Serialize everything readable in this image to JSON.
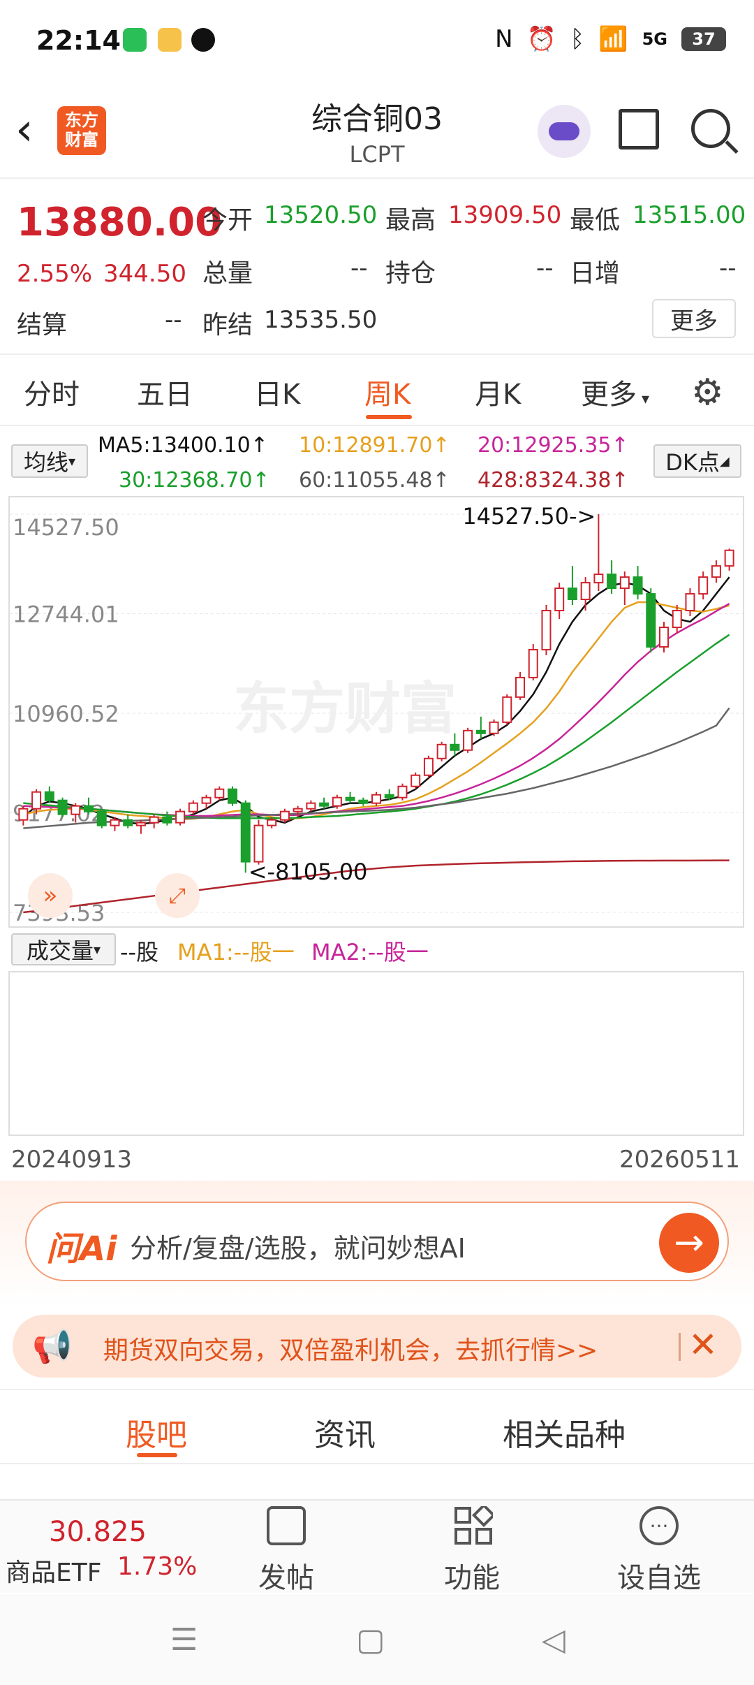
{
  "status_bar": {
    "time": "22:14",
    "battery": "37",
    "network": "5G"
  },
  "header": {
    "logo_line1": "东方",
    "logo_line2": "财富",
    "title": "综合铜03",
    "subtitle": "LCPT"
  },
  "quote": {
    "price": "13880.00",
    "pct": "2.55%",
    "change": "344.50",
    "open_label": "今开",
    "open": "13520.50",
    "high_label": "最高",
    "high": "13909.50",
    "low_label": "最低",
    "low": "13515.00",
    "volume_label": "总量",
    "volume": "--",
    "oi_label": "持仓",
    "oi": "--",
    "daily_inc_label": "日增",
    "daily_inc": "--",
    "settle_label": "结算",
    "settle": "--",
    "prev_settle_label": "昨结",
    "prev_settle": "13535.50",
    "more": "更多"
  },
  "period_tabs": [
    "分时",
    "五日",
    "日K",
    "周K",
    "月K",
    "更多"
  ],
  "ma": {
    "selector": "均线",
    "ma5": "MA5:13400.10↑",
    "ma10": "10:12891.70↑",
    "ma20": "20:12925.35↑",
    "ma30": "30:12368.70↑",
    "ma60": "60:11055.48↑",
    "ma428": "428:8324.38↑",
    "dk": "DK点"
  },
  "colors": {
    "ma5": "#111111",
    "ma10": "#e6a01e",
    "ma20": "#c8259a",
    "ma30": "#1a9f2c",
    "ma60": "#666666",
    "ma428": "#b0242c",
    "up": "#d0232d",
    "down": "#1a9f2c",
    "accent": "#f05a22"
  },
  "chart_data": {
    "type": "candlestick",
    "y_ticks": [
      "14527.50",
      "12744.01",
      "10960.52",
      "9177.02",
      "7393.53"
    ],
    "ylim": [
      7393.53,
      14527.5
    ],
    "max_label": "14527.50->",
    "min_label": "<-8105.00",
    "x_start": "20240913",
    "x_end": "20260511",
    "watermark": "东方财富",
    "candles_ohlc": [
      [
        9050,
        9300,
        8950,
        9250
      ],
      [
        9250,
        9600,
        9150,
        9550
      ],
      [
        9550,
        9650,
        9350,
        9400
      ],
      [
        9400,
        9450,
        9100,
        9150
      ],
      [
        9150,
        9350,
        9000,
        9300
      ],
      [
        9300,
        9450,
        9150,
        9200
      ],
      [
        9200,
        9250,
        8900,
        8950
      ],
      [
        8950,
        9100,
        8850,
        9050
      ],
      [
        9050,
        9150,
        8900,
        8950
      ],
      [
        8950,
        9050,
        8800,
        9000
      ],
      [
        9000,
        9150,
        8900,
        9100
      ],
      [
        9100,
        9200,
        8950,
        9000
      ],
      [
        9000,
        9250,
        8950,
        9200
      ],
      [
        9200,
        9400,
        9150,
        9350
      ],
      [
        9350,
        9500,
        9250,
        9450
      ],
      [
        9450,
        9650,
        9400,
        9600
      ],
      [
        9600,
        9650,
        9300,
        9350
      ],
      [
        9350,
        9400,
        8105,
        8300
      ],
      [
        8300,
        9050,
        8250,
        8950
      ],
      [
        8950,
        9100,
        8900,
        9050
      ],
      [
        9050,
        9250,
        9000,
        9200
      ],
      [
        9200,
        9300,
        9100,
        9250
      ],
      [
        9250,
        9400,
        9200,
        9350
      ],
      [
        9350,
        9450,
        9250,
        9300
      ],
      [
        9300,
        9500,
        9250,
        9450
      ],
      [
        9450,
        9550,
        9350,
        9400
      ],
      [
        9400,
        9450,
        9300,
        9350
      ],
      [
        9350,
        9550,
        9300,
        9500
      ],
      [
        9500,
        9600,
        9400,
        9450
      ],
      [
        9450,
        9700,
        9400,
        9650
      ],
      [
        9650,
        9900,
        9600,
        9850
      ],
      [
        9850,
        10200,
        9800,
        10150
      ],
      [
        10150,
        10450,
        10100,
        10400
      ],
      [
        10400,
        10600,
        10200,
        10300
      ],
      [
        10300,
        10700,
        10250,
        10650
      ],
      [
        10650,
        10900,
        10500,
        10600
      ],
      [
        10600,
        10850,
        10550,
        10800
      ],
      [
        10800,
        11300,
        10750,
        11250
      ],
      [
        11250,
        11700,
        11200,
        11600
      ],
      [
        11600,
        12200,
        11550,
        12100
      ],
      [
        12100,
        12900,
        12000,
        12800
      ],
      [
        12800,
        13300,
        12650,
        13200
      ],
      [
        13200,
        13600,
        12900,
        13000
      ],
      [
        13000,
        13400,
        12800,
        13300
      ],
      [
        13300,
        14527.5,
        13150,
        13450
      ],
      [
        13450,
        13700,
        13100,
        13200
      ],
      [
        13200,
        13500,
        12900,
        13400
      ],
      [
        13400,
        13600,
        13000,
        13100
      ],
      [
        13100,
        13200,
        12050,
        12150
      ],
      [
        12150,
        12600,
        12050,
        12500
      ],
      [
        12500,
        12900,
        12400,
        12800
      ],
      [
        12800,
        13200,
        12700,
        13100
      ],
      [
        13100,
        13500,
        13000,
        13400
      ],
      [
        13400,
        13700,
        13300,
        13600
      ],
      [
        13600,
        13909.5,
        13515,
        13880
      ]
    ],
    "ma_lines": [
      {
        "name": "MA5",
        "values": [
          9100,
          9300,
          9380,
          9350,
          9300,
          9250,
          9150,
          9080,
          9000,
          8980,
          9000,
          9050,
          9080,
          9150,
          9250,
          9400,
          9450,
          9300,
          9100,
          9050,
          9000,
          9100,
          9200,
          9250,
          9300,
          9350,
          9350,
          9380,
          9420,
          9480,
          9600,
          9800,
          10000,
          10200,
          10350,
          10500,
          10600,
          10750,
          11000,
          11300,
          11700,
          12200,
          12600,
          12900,
          13100,
          13250,
          13300,
          13250,
          13100,
          12800,
          12650,
          12600,
          12800,
          13100,
          13400
        ]
      },
      {
        "name": "MA10",
        "values": [
          9150,
          9200,
          9230,
          9240,
          9250,
          9230,
          9200,
          9170,
          9140,
          9120,
          9100,
          9080,
          9060,
          9070,
          9100,
          9150,
          9200,
          9230,
          9150,
          9100,
          9070,
          9080,
          9100,
          9150,
          9200,
          9250,
          9280,
          9300,
          9320,
          9360,
          9420,
          9520,
          9640,
          9780,
          9920,
          10080,
          10250,
          10420,
          10600,
          10800,
          11050,
          11350,
          11700,
          12000,
          12300,
          12600,
          12850,
          12950,
          12950,
          12900,
          12850,
          12800,
          12780,
          12830,
          12891
        ]
      },
      {
        "name": "MA20",
        "values": [
          9300,
          9290,
          9280,
          9270,
          9260,
          9250,
          9230,
          9210,
          9190,
          9170,
          9150,
          9140,
          9130,
          9120,
          9120,
          9130,
          9140,
          9150,
          9150,
          9140,
          9130,
          9140,
          9160,
          9180,
          9200,
          9220,
          9240,
          9260,
          9280,
          9300,
          9340,
          9390,
          9450,
          9520,
          9600,
          9690,
          9790,
          9900,
          10020,
          10160,
          10320,
          10500,
          10710,
          10930,
          11160,
          11400,
          11650,
          11880,
          12080,
          12250,
          12400,
          12530,
          12650,
          12790,
          12925
        ]
      },
      {
        "name": "MA30",
        "values": [
          9350,
          9330,
          9310,
          9290,
          9270,
          9250,
          9230,
          9210,
          9190,
          9170,
          9150,
          9130,
          9110,
          9100,
          9090,
          9080,
          9080,
          9080,
          9080,
          9080,
          9080,
          9090,
          9100,
          9110,
          9120,
          9140,
          9160,
          9180,
          9200,
          9220,
          9250,
          9290,
          9330,
          9380,
          9440,
          9510,
          9590,
          9680,
          9780,
          9890,
          10010,
          10150,
          10300,
          10460,
          10630,
          10800,
          10980,
          11160,
          11340,
          11520,
          11700,
          11870,
          12040,
          12210,
          12368
        ]
      },
      {
        "name": "MA60",
        "values": [
          8900,
          8920,
          8940,
          8960,
          8980,
          9000,
          9010,
          9020,
          9030,
          9040,
          9050,
          9060,
          9070,
          9080,
          9090,
          9100,
          9110,
          9120,
          9130,
          9140,
          9150,
          9160,
          9170,
          9180,
          9190,
          9200,
          9210,
          9220,
          9230,
          9250,
          9270,
          9300,
          9330,
          9360,
          9400,
          9440,
          9480,
          9520,
          9570,
          9620,
          9680,
          9740,
          9800,
          9870,
          9940,
          10010,
          10090,
          10170,
          10250,
          10340,
          10430,
          10530,
          10630,
          10740,
          11055
        ]
      },
      {
        "name": "MA428",
        "values": [
          7393,
          7420,
          7450,
          7480,
          7510,
          7540,
          7570,
          7600,
          7630,
          7660,
          7690,
          7720,
          7750,
          7780,
          7810,
          7840,
          7870,
          7900,
          7930,
          7960,
          7990,
          8020,
          8050,
          8080,
          8110,
          8140,
          8160,
          8180,
          8200,
          8215,
          8230,
          8240,
          8250,
          8258,
          8266,
          8272,
          8278,
          8284,
          8290,
          8295,
          8300,
          8304,
          8308,
          8311,
          8314,
          8316,
          8318,
          8319,
          8320,
          8321,
          8322,
          8322,
          8323,
          8324,
          8324
        ]
      }
    ]
  },
  "volume": {
    "selector": "成交量",
    "unit": "--股",
    "ma1": "MA1:--股一",
    "ma2": "MA2:--股一"
  },
  "ai": {
    "logo": "问Ai",
    "prompt": "分析/复盘/选股，就问妙想AI",
    "go": "→"
  },
  "promo": {
    "text": "期货双向交易，双倍盈利机会，去抓行情>>",
    "close": "✕"
  },
  "bottom_tabs": [
    "股吧",
    "资讯",
    "相关品种"
  ],
  "bottom_nav": {
    "etf_price": "30.825",
    "etf_name": "商品ETF",
    "etf_pct": "1.73%",
    "post": "发帖",
    "func": "功能",
    "fav": "设自选"
  }
}
